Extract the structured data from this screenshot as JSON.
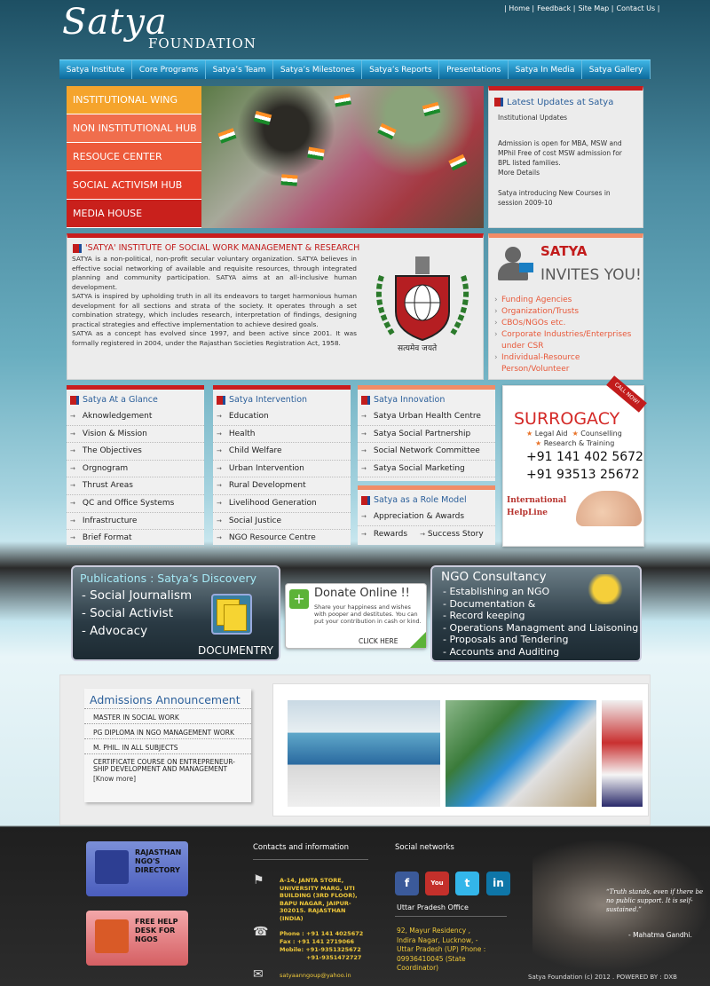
{
  "logo": {
    "main": "Satya",
    "sub": "FOUNDATION"
  },
  "toplinks": [
    "| Home |",
    "Feedback |",
    "Site Map |",
    "Contact Us |"
  ],
  "nav": [
    "Satya Institute",
    "Core Programs",
    "Satya’s Team",
    "Satya’s Milestones",
    "Satya’s Reports",
    "Presentations",
    "Satya In Media",
    "Satya Gallery"
  ],
  "wing": [
    {
      "label": "INSTITUTIONAL WING",
      "color": "#f5a42c"
    },
    {
      "label": "NON INSTITUTIONAL HUB",
      "color": "#f06e4d"
    },
    {
      "label": "RESOUCE CENTER",
      "color": "#ed5a3a"
    },
    {
      "label": "SOCIAL ACTIVISM HUB",
      "color": "#e23b28"
    },
    {
      "label": "MEDIA HOUSE",
      "color": "#c9201c"
    }
  ],
  "updates": {
    "title": "Latest Updates at Satya",
    "p1": "Institutional Updates",
    "p2": "Admission is open for MBA, MSW and MPhil Free of cost MSW admission for BPL listed families.",
    "p3": "More Details",
    "p4": "Satya introducing New Courses in session 2009-10"
  },
  "institute": {
    "title": "'SATYA' INSTITUTE OF SOCIAL WORK MANAGEMENT & RESEARCH",
    "p1": "SATYA is a non-political, non-profit secular voluntary organization. SATYA believes in effective social networking of available and requisite resources, through integrated planning and community participation. SATYA aims at an all-inclusive human development.",
    "p2": "SATYA is inspired by upholding truth in all its endeavors to target harmonious human development for all sections and strata of the society. It operates through a set combination strategy, which includes research, interpretation of findings, designing practical strategies and effective implementation to achieve desired goals.",
    "p3": "SATYA as a concept has evolved since 1997, and been active since 2001. It was formally registered in 2004, under the Rajasthan Societies Registration Act, 1958.",
    "emblem_text": "सत्यमेव जयते"
  },
  "invites": {
    "t1": "SATYA",
    "t2": "INVITES YOU!",
    "items": [
      "Funding Agencies",
      "Organization/Trusts",
      "CBOs/NGOs etc.",
      "Corporate Industries/Enterprises under CSR",
      "Individual-Resource Person/Volunteer"
    ]
  },
  "glance": {
    "title": "Satya At a Glance",
    "items": [
      "Aknowledgement",
      "Vision & Mission",
      "The Objectives",
      "Orgnogram",
      "Thrust Areas",
      "QC and Office Systems",
      "Infrastructure",
      "Brief Format"
    ]
  },
  "intervention": {
    "title": "Satya Intervention",
    "items": [
      "Education",
      "Health",
      "Child Welfare",
      "Urban Intervention",
      "Rural Development",
      "Livelihood Generation",
      "Social Justice",
      "NGO Resource Centre"
    ]
  },
  "innovation": {
    "title": "Satya Innovation",
    "items": [
      "Satya Urban Health Centre",
      "Satya Social Partnership",
      "Social Network Committee",
      "Satya Social Marketing"
    ]
  },
  "role": {
    "title": "Satya as a Role Model",
    "items": [
      "Appreciation & Awards",
      "Rewards",
      "Success Story"
    ]
  },
  "surrogacy": {
    "call": "CALL NOW!",
    "title": "SURROGACY",
    "s1": "Legal Aid",
    "s1b": "Counselling",
    "s2": "Research & Training",
    "phone1": "+91 141 402 5672",
    "phone2": "+91 93513 25672",
    "intl1": "International",
    "intl2": "HelpLine"
  },
  "pubs": {
    "title": "Publications : Satya’s Discovery",
    "items": [
      "- Social Journalism",
      "- Social Activist",
      "- Advocacy"
    ],
    "doc": "DOCUMENTRY"
  },
  "donate": {
    "title": "Donate Online !!",
    "desc": "Share your happiness and wishes with pooper and destitutes. You can put your contribution in cash or kind.",
    "click": "CLICK HERE"
  },
  "ngo": {
    "title": "NGO Consultancy",
    "items": [
      "- Establishing an NGO",
      "- Documentation &",
      "- Record keeping",
      "- Operations Managment and Liaisoning",
      "- Proposals and Tendering",
      "- Accounts and Auditing"
    ]
  },
  "admissions": {
    "title": "Admissions Announcement",
    "items": [
      "MASTER IN SOCIAL WORK",
      "PG DIPLOMA IN NGO MANAGEMENT WORK",
      "M. PHIL. IN ALL SUBJECTS",
      "CERTIFICATE COURSE ON ENTREPRENEUR-SHIP DEVELOPMENT AND MANAGEMENT"
    ],
    "more": "[Know more]"
  },
  "footer": {
    "dir1": "RAJASTHAN NGO'S DIRECTORY",
    "dir2": "FREE HELP DESK FOR NGOS",
    "contacts_title": "Contacts and information",
    "address": "A-14, JANTA STORE, UNIVERSITY MARG, UTI BUILDING (3RD FLOOR), BAPU NAGAR, JAIPUR-302015. RAJASTHAN (INDIA)",
    "phone": "Phone : +91 141 4025672",
    "fax": "Fax :   +91 141 2719066",
    "mobile": "Mobile: +91-9351325672",
    "mobile2": "+91-9351472727",
    "email": "satyaanngoup@yahoo.in",
    "social_title": "Social networks",
    "up_title": "Uttar Pradesh Office",
    "up_address": "92, Mayur Residency , Indira Nagar, Lucknow, -Uttar Pradesh (UP) Phone : 09936410045 (State Coordinator)",
    "quote": "“Truth stands, even if there be no public support. It is self-sustained.”",
    "quote_by": "- Mahatma Gandhi.",
    "copyright": "Satya Foundation (c) 2012 . POWERED BY : DXB"
  }
}
